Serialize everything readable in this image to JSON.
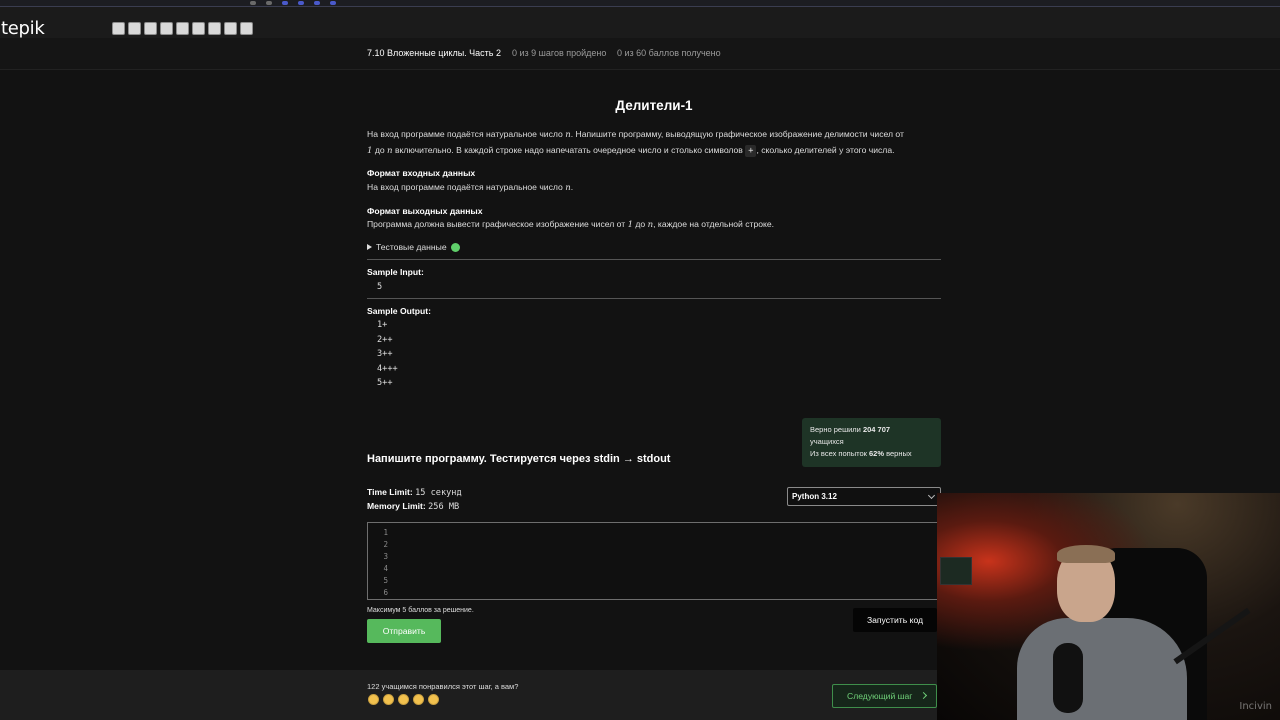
{
  "header": {
    "logo_text": "tepik",
    "step_count": 9
  },
  "lesson": {
    "title": "7.10 Вложенные циклы. Часть 2",
    "steps_progress": "0 из 9 шагов пройдено",
    "points_progress": "0 из 60 баллов  получено"
  },
  "problem": {
    "title": "Делители-1",
    "intro_part1": "На вход программе подаётся натуральное число ",
    "var_n": "n",
    "intro_part2": ". Напишите программу, выводящую графическое изображение делимости чисел от",
    "intro_one": "1",
    "intro_to": " до ",
    "intro_part3": " включительно. В каждой строке надо напечатать очередное число и столько символов ",
    "plus_symbol": "+",
    "intro_part4": ", сколько делителей у этого числа.",
    "input_format_title": "Формат входных данных",
    "input_format_text": "На вход программе подаётся натуральное число ",
    "input_format_end": ".",
    "output_format_title": "Формат выходных данных",
    "output_format_text": "Программа должна вывести графическое изображение чисел от ",
    "output_format_end": ", каждое на отдельной строке.",
    "tests_label": "Тестовые данные",
    "sample_input_label": "Sample Input:",
    "sample_input": [
      "5"
    ],
    "sample_output_label": "Sample Output:",
    "sample_output": [
      "1+",
      "2++",
      "3++",
      "4+++",
      "5++"
    ]
  },
  "stats": {
    "solved_prefix": "Верно решили ",
    "solved_count": "204 707",
    "solved_suffix": "учащихся",
    "attempts_prefix": "Из всех попыток ",
    "attempts_percent": "62%",
    "attempts_suffix": " верных"
  },
  "code_task": {
    "title": "Напишите программу. Тестируется через stdin → stdout",
    "time_limit_label": "Time Limit:",
    "time_limit_value": "15 секунд",
    "memory_limit_label": "Memory Limit:",
    "memory_limit_value": "256 MB",
    "language": "Python 3.12",
    "line_numbers": [
      "1",
      "2",
      "3",
      "4",
      "5",
      "6"
    ],
    "max_points_note": "Максимум 5 баллов за решение.",
    "submit_label": "Отправить",
    "run_label": "Запустить код"
  },
  "footer": {
    "likes_text": "122 учащимся понравился этот шаг, а вам?",
    "rating_count": 5,
    "next_step_label": "Следующий шаг"
  },
  "webcam": {
    "watermark": "Incivin"
  },
  "colors": {
    "accent_green": "#56b95c",
    "stats_bg": "#1e3426",
    "page_bg": "#121212"
  }
}
